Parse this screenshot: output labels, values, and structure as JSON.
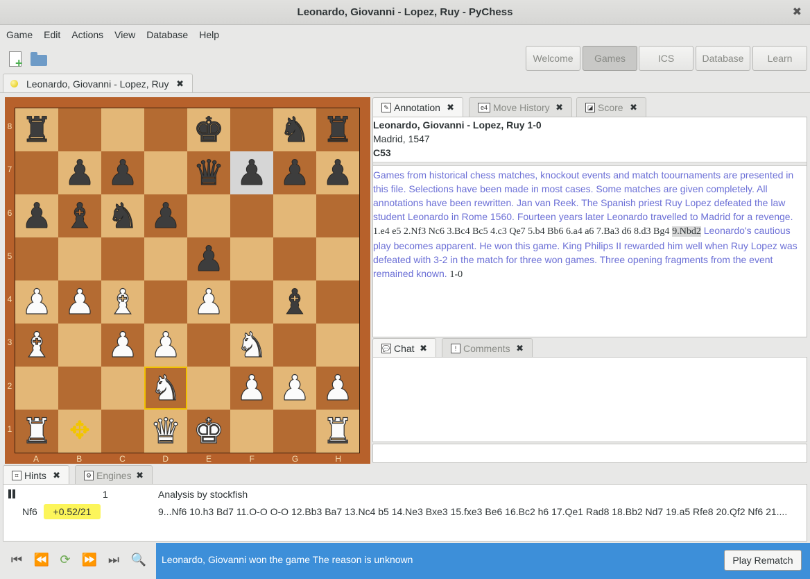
{
  "window": {
    "title": "Leonardo, Giovanni - Lopez, Ruy - PyChess",
    "close_glyph": "✖"
  },
  "menu": [
    "Game",
    "Edit",
    "Actions",
    "View",
    "Database",
    "Help"
  ],
  "nav": [
    {
      "label": "Welcome",
      "active": false
    },
    {
      "label": "Games",
      "active": true
    },
    {
      "label": "ICS",
      "active": false
    },
    {
      "label": "Database",
      "active": false
    },
    {
      "label": "Learn",
      "active": false
    }
  ],
  "game_tab": {
    "label": "Leonardo, Giovanni - Lopez, Ruy",
    "close": "✖"
  },
  "board": {
    "ranks": [
      "8",
      "7",
      "6",
      "5",
      "4",
      "3",
      "2",
      "1"
    ],
    "files": [
      "A",
      "B",
      "C",
      "D",
      "E",
      "F",
      "G",
      "H"
    ],
    "fen": "r3k1nr/1pp1qppp/pbnp4/4p3/PPB1P1b1/B1PP1N2/3N1PPP/R2QK2R",
    "highlight_gray": "f7",
    "highlight_moved": "d2",
    "target_marker": "b1"
  },
  "annotation_tabs": [
    {
      "label": "Annotation",
      "icon": "✎",
      "close": "✖",
      "active": true
    },
    {
      "label": "Move History",
      "icon": "e4",
      "close": "✖",
      "active": false
    },
    {
      "label": "Score",
      "icon": "◪",
      "close": "✖",
      "active": false
    }
  ],
  "annotation": {
    "players": "Leonardo, Giovanni - Lopez, Ruy 1-0",
    "place": "Madrid, 1547",
    "eco": "C53",
    "comment": "Games from historical chess matches, knockout events and match toournaments are presented in this file. Selections have been made in most cases. Some matches are given completely. All annotations have been rewritten.   Jan van Reek.   The Spanish priest Ruy Lopez defeated the law student Leonardo in Rome 1560. Fourteen years later Leonardo travelled to Madrid for a revenge.",
    "moves": "1.e4 e5 2.Nf3 Nc6 3.Bc4 Bc5 4.c3 Qe7 5.b4 Bb6 6.a4 a6 7.Ba3 d6 8.d3 Bg4",
    "current_move": "9.Nbd2",
    "comment2": "Leonardo's cautious play becomes apparent. He won this game. King Philips II rewarded him well when Ruy Lopez was defeated with 3-2 in the match for three won games. Three opening fragments from the event remained known.",
    "result": "1-0"
  },
  "chat_tabs": [
    {
      "label": "Chat",
      "icon": "💬",
      "close": "✖",
      "active": true
    },
    {
      "label": "Comments",
      "icon": "!",
      "close": "✖",
      "active": false
    }
  ],
  "hint_tabs": [
    {
      "label": "Hints",
      "icon": "⌗",
      "close": "✖",
      "active": true
    },
    {
      "label": "Engines",
      "icon": "⚙",
      "close": "✖",
      "active": false
    }
  ],
  "hints": {
    "multipv": "1",
    "engine_label": "Analysis by stockfish",
    "best_move": "Nf6",
    "score": "+0.52/21",
    "line": "9...Nf6 10.h3 Bd7 11.O-O O-O 12.Bb3 Ba7 13.Nc4 b5 14.Ne3 Bxe3 15.fxe3 Be6 16.Bc2 h6 17.Qe1 Rad8 18.Bb2 Nd7 19.a5 Rfe8 20.Qf2 Nf6 21...."
  },
  "controls": [
    "⏮",
    "⏪",
    "⟳",
    "⏩",
    "⏭",
    "🔍"
  ],
  "infobar": {
    "message": "Leonardo, Giovanni won the game The reason is unknown",
    "button": "Play Rematch",
    "color": "#3d8fd9"
  }
}
